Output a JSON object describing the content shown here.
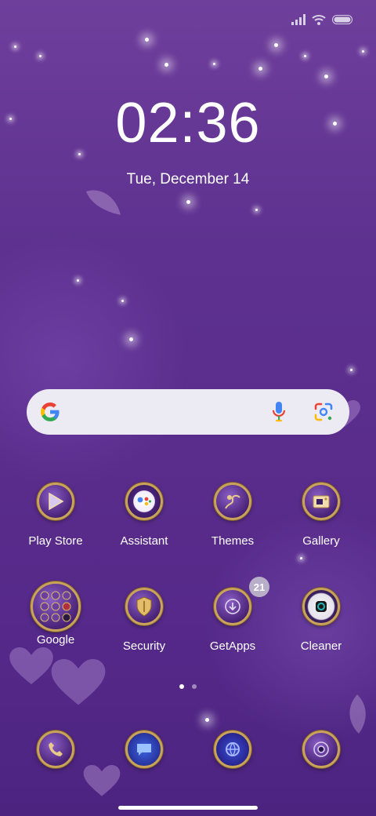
{
  "status_bar": {
    "signal_icon": "signal-bars-icon",
    "wifi_icon": "wifi-icon",
    "battery_icon": "battery-icon"
  },
  "lockscreen": {
    "time": "02:36",
    "date": "Tue, December 14"
  },
  "search": {
    "logo_icon": "google-g-icon",
    "mic_icon": "microphone-icon",
    "lens_icon": "google-lens-icon"
  },
  "apps_row1": [
    {
      "label": "Play Store",
      "icon": "play-store-icon"
    },
    {
      "label": "Assistant",
      "icon": "assistant-icon"
    },
    {
      "label": "Themes",
      "icon": "themes-icon"
    },
    {
      "label": "Gallery",
      "icon": "gallery-icon"
    }
  ],
  "apps_row2": [
    {
      "label": "Google",
      "icon": "google-folder-icon"
    },
    {
      "label": "Security",
      "icon": "security-icon"
    },
    {
      "label": "GetApps",
      "icon": "getapps-icon",
      "badge": "21"
    },
    {
      "label": "Cleaner",
      "icon": "cleaner-icon"
    }
  ],
  "dock": [
    {
      "icon": "phone-icon"
    },
    {
      "icon": "messages-icon"
    },
    {
      "icon": "browser-icon"
    },
    {
      "icon": "camera-icon"
    }
  ],
  "page_indicator": {
    "pages": 2,
    "active": 1
  },
  "colors": {
    "wallpaper": "#5e3190",
    "icon_rim": "#c9a35a",
    "search_bg": "#eceaf2"
  }
}
